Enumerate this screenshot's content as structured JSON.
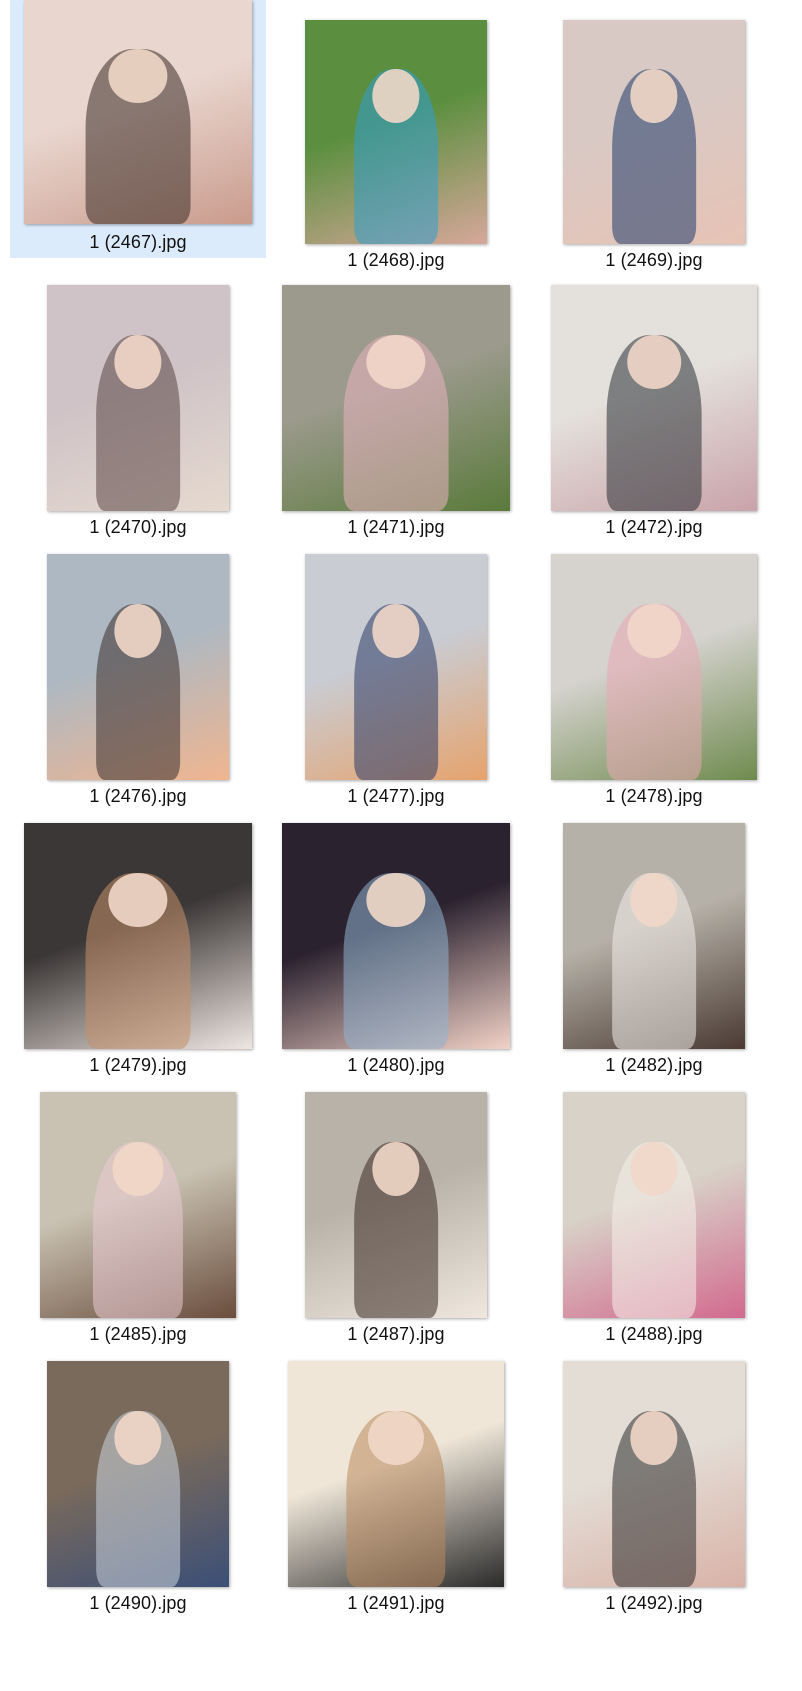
{
  "files": [
    {
      "name": "1 (2467).jpg",
      "selected": true,
      "colors": [
        "#e9d6cf",
        "#3a2b27",
        "#c99b8c"
      ]
    },
    {
      "name": "1 (2468).jpg",
      "selected": false,
      "colors": [
        "#5b8f3f",
        "#2f9ed1",
        "#d7a79a"
      ]
    },
    {
      "name": "1 (2469).jpg",
      "selected": false,
      "colors": [
        "#d9c9c4",
        "#1f3a6b",
        "#e7c3b5"
      ]
    },
    {
      "name": "1 (2470).jpg",
      "selected": false,
      "colors": [
        "#cfc3c7",
        "#5a4643",
        "#e6d9cf"
      ]
    },
    {
      "name": "1 (2471).jpg",
      "selected": false,
      "colors": [
        "#9b9a8c",
        "#e7b3bf",
        "#5a7a3b"
      ]
    },
    {
      "name": "1 (2472).jpg",
      "selected": false,
      "colors": [
        "#e4e1dc",
        "#2a2f35",
        "#c9a3a9"
      ]
    },
    {
      "name": "1 (2476).jpg",
      "selected": false,
      "colors": [
        "#aeb8c2",
        "#3b2e2b",
        "#f0b58f"
      ]
    },
    {
      "name": "1 (2477).jpg",
      "selected": false,
      "colors": [
        "#c9ccd3",
        "#2c3a66",
        "#e6a36d"
      ]
    },
    {
      "name": "1 (2478).jpg",
      "selected": false,
      "colors": [
        "#d6d3cf",
        "#e8a8b2",
        "#6f8b4f"
      ]
    },
    {
      "name": "1 (2479).jpg",
      "selected": false,
      "colors": [
        "#3b3736",
        "#c58f6a",
        "#efe6e2"
      ]
    },
    {
      "name": "1 (2480).jpg",
      "selected": false,
      "colors": [
        "#2b2230",
        "#8fb3cf",
        "#f2d2c7"
      ]
    },
    {
      "name": "1 (2482).jpg",
      "selected": false,
      "colors": [
        "#b6b1a8",
        "#f1ece8",
        "#4a3a33"
      ]
    },
    {
      "name": "1 (2485).jpg",
      "selected": false,
      "colors": [
        "#c9c2b2",
        "#e9cbd3",
        "#6a4d3d"
      ]
    },
    {
      "name": "1 (2487).jpg",
      "selected": false,
      "colors": [
        "#b9b2a8",
        "#3b2a25",
        "#efe7de"
      ]
    },
    {
      "name": "1 (2488).jpg",
      "selected": false,
      "colors": [
        "#d8d2c8",
        "#f5f0ea",
        "#d26a8f"
      ]
    },
    {
      "name": "1 (2490).jpg",
      "selected": false,
      "colors": [
        "#7a6a5b",
        "#cbd3de",
        "#3b4f77"
      ]
    },
    {
      "name": "1 (2491).jpg",
      "selected": false,
      "colors": [
        "#efe6d8",
        "#b98a5e",
        "#2a2a2a"
      ]
    },
    {
      "name": "1 (2492).jpg",
      "selected": false,
      "colors": [
        "#e3ddd6",
        "#2b2b2b",
        "#d9b2a7"
      ]
    }
  ]
}
